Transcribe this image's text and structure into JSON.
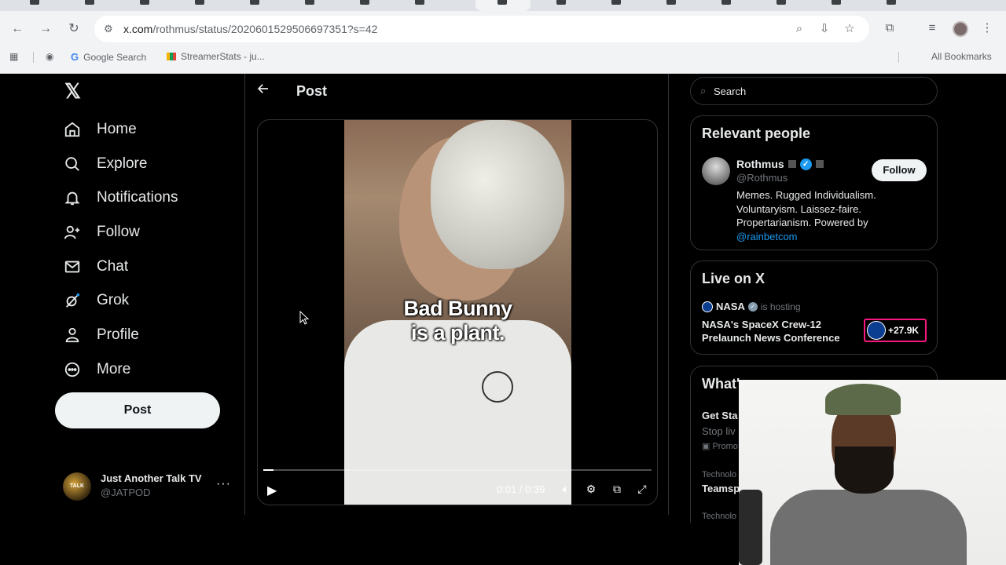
{
  "browser": {
    "url_main": "x.com",
    "url_rest": "/rothmus/status/2020601529506697351?s=42",
    "bookmarks": [
      "Google Search",
      "StreamerStats - ju..."
    ],
    "all_bookmarks": "All Bookmarks"
  },
  "sidebar": {
    "logo": "𝕏",
    "items": [
      {
        "label": "Home",
        "icon": "home-icon"
      },
      {
        "label": "Explore",
        "icon": "search-icon"
      },
      {
        "label": "Notifications",
        "icon": "bell-icon"
      },
      {
        "label": "Follow",
        "icon": "person-plus-icon"
      },
      {
        "label": "Chat",
        "icon": "mail-icon"
      },
      {
        "label": "Grok",
        "icon": "grok-icon"
      },
      {
        "label": "Profile",
        "icon": "person-icon"
      },
      {
        "label": "More",
        "icon": "more-circle-icon"
      }
    ],
    "post_button": "Post",
    "account": {
      "name": "Just Another Talk TV",
      "handle": "@JATPOD",
      "avatar_text": "TALK"
    }
  },
  "main": {
    "title": "Post",
    "video": {
      "caption_line1": "Bad Bunny",
      "caption_line2": "is a plant.",
      "time": "0:01 / 0:39",
      "progress": 0.026
    }
  },
  "right": {
    "search_placeholder": "Search",
    "relevant": {
      "title": "Relevant people",
      "name": "Rothmus",
      "handle": "@Rothmus",
      "follow": "Follow",
      "bio_line1": "Memes. Rugged Individualism.",
      "bio_line2": "Voluntaryism. Laissez-faire.",
      "bio_line3": "Propertarianism. Powered by",
      "bio_link": "@rainbetcom"
    },
    "live": {
      "title": "Live on X",
      "host": "NASA",
      "hosting": "is hosting",
      "event": "NASA's SpaceX Crew-12 Prelaunch News Conference",
      "count": "+27.9K"
    },
    "trending": {
      "title_partial": "What's",
      "item1_title": "Get Sta",
      "item1_sub": "Stop liv",
      "item1_promo": "Promo",
      "item2_cat": "Technolo",
      "item2_title": "Teamsp",
      "item3_cat": "Technolo"
    }
  },
  "colors": {
    "accent": "#1d9bf0",
    "live_border": "#f91880",
    "bg": "#000000"
  }
}
